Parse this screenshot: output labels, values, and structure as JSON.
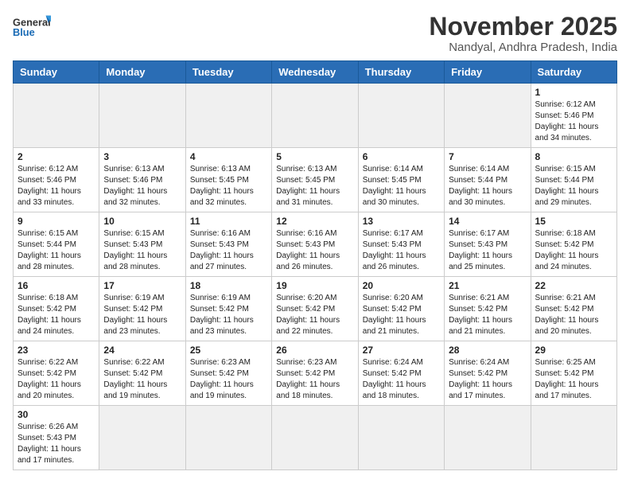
{
  "header": {
    "logo_general": "General",
    "logo_blue": "Blue",
    "month_title": "November 2025",
    "location": "Nandyal, Andhra Pradesh, India"
  },
  "weekdays": [
    "Sunday",
    "Monday",
    "Tuesday",
    "Wednesday",
    "Thursday",
    "Friday",
    "Saturday"
  ],
  "weeks": [
    [
      {
        "day": "",
        "info": ""
      },
      {
        "day": "",
        "info": ""
      },
      {
        "day": "",
        "info": ""
      },
      {
        "day": "",
        "info": ""
      },
      {
        "day": "",
        "info": ""
      },
      {
        "day": "",
        "info": ""
      },
      {
        "day": "1",
        "info": "Sunrise: 6:12 AM\nSunset: 5:46 PM\nDaylight: 11 hours and 34 minutes."
      }
    ],
    [
      {
        "day": "2",
        "info": "Sunrise: 6:12 AM\nSunset: 5:46 PM\nDaylight: 11 hours and 33 minutes."
      },
      {
        "day": "3",
        "info": "Sunrise: 6:13 AM\nSunset: 5:46 PM\nDaylight: 11 hours and 32 minutes."
      },
      {
        "day": "4",
        "info": "Sunrise: 6:13 AM\nSunset: 5:45 PM\nDaylight: 11 hours and 32 minutes."
      },
      {
        "day": "5",
        "info": "Sunrise: 6:13 AM\nSunset: 5:45 PM\nDaylight: 11 hours and 31 minutes."
      },
      {
        "day": "6",
        "info": "Sunrise: 6:14 AM\nSunset: 5:45 PM\nDaylight: 11 hours and 30 minutes."
      },
      {
        "day": "7",
        "info": "Sunrise: 6:14 AM\nSunset: 5:44 PM\nDaylight: 11 hours and 30 minutes."
      },
      {
        "day": "8",
        "info": "Sunrise: 6:15 AM\nSunset: 5:44 PM\nDaylight: 11 hours and 29 minutes."
      }
    ],
    [
      {
        "day": "9",
        "info": "Sunrise: 6:15 AM\nSunset: 5:44 PM\nDaylight: 11 hours and 28 minutes."
      },
      {
        "day": "10",
        "info": "Sunrise: 6:15 AM\nSunset: 5:43 PM\nDaylight: 11 hours and 28 minutes."
      },
      {
        "day": "11",
        "info": "Sunrise: 6:16 AM\nSunset: 5:43 PM\nDaylight: 11 hours and 27 minutes."
      },
      {
        "day": "12",
        "info": "Sunrise: 6:16 AM\nSunset: 5:43 PM\nDaylight: 11 hours and 26 minutes."
      },
      {
        "day": "13",
        "info": "Sunrise: 6:17 AM\nSunset: 5:43 PM\nDaylight: 11 hours and 26 minutes."
      },
      {
        "day": "14",
        "info": "Sunrise: 6:17 AM\nSunset: 5:43 PM\nDaylight: 11 hours and 25 minutes."
      },
      {
        "day": "15",
        "info": "Sunrise: 6:18 AM\nSunset: 5:42 PM\nDaylight: 11 hours and 24 minutes."
      }
    ],
    [
      {
        "day": "16",
        "info": "Sunrise: 6:18 AM\nSunset: 5:42 PM\nDaylight: 11 hours and 24 minutes."
      },
      {
        "day": "17",
        "info": "Sunrise: 6:19 AM\nSunset: 5:42 PM\nDaylight: 11 hours and 23 minutes."
      },
      {
        "day": "18",
        "info": "Sunrise: 6:19 AM\nSunset: 5:42 PM\nDaylight: 11 hours and 23 minutes."
      },
      {
        "day": "19",
        "info": "Sunrise: 6:20 AM\nSunset: 5:42 PM\nDaylight: 11 hours and 22 minutes."
      },
      {
        "day": "20",
        "info": "Sunrise: 6:20 AM\nSunset: 5:42 PM\nDaylight: 11 hours and 21 minutes."
      },
      {
        "day": "21",
        "info": "Sunrise: 6:21 AM\nSunset: 5:42 PM\nDaylight: 11 hours and 21 minutes."
      },
      {
        "day": "22",
        "info": "Sunrise: 6:21 AM\nSunset: 5:42 PM\nDaylight: 11 hours and 20 minutes."
      }
    ],
    [
      {
        "day": "23",
        "info": "Sunrise: 6:22 AM\nSunset: 5:42 PM\nDaylight: 11 hours and 20 minutes."
      },
      {
        "day": "24",
        "info": "Sunrise: 6:22 AM\nSunset: 5:42 PM\nDaylight: 11 hours and 19 minutes."
      },
      {
        "day": "25",
        "info": "Sunrise: 6:23 AM\nSunset: 5:42 PM\nDaylight: 11 hours and 19 minutes."
      },
      {
        "day": "26",
        "info": "Sunrise: 6:23 AM\nSunset: 5:42 PM\nDaylight: 11 hours and 18 minutes."
      },
      {
        "day": "27",
        "info": "Sunrise: 6:24 AM\nSunset: 5:42 PM\nDaylight: 11 hours and 18 minutes."
      },
      {
        "day": "28",
        "info": "Sunrise: 6:24 AM\nSunset: 5:42 PM\nDaylight: 11 hours and 17 minutes."
      },
      {
        "day": "29",
        "info": "Sunrise: 6:25 AM\nSunset: 5:42 PM\nDaylight: 11 hours and 17 minutes."
      }
    ],
    [
      {
        "day": "30",
        "info": "Sunrise: 6:26 AM\nSunset: 5:43 PM\nDaylight: 11 hours and 17 minutes."
      },
      {
        "day": "",
        "info": ""
      },
      {
        "day": "",
        "info": ""
      },
      {
        "day": "",
        "info": ""
      },
      {
        "day": "",
        "info": ""
      },
      {
        "day": "",
        "info": ""
      },
      {
        "day": "",
        "info": ""
      }
    ]
  ]
}
